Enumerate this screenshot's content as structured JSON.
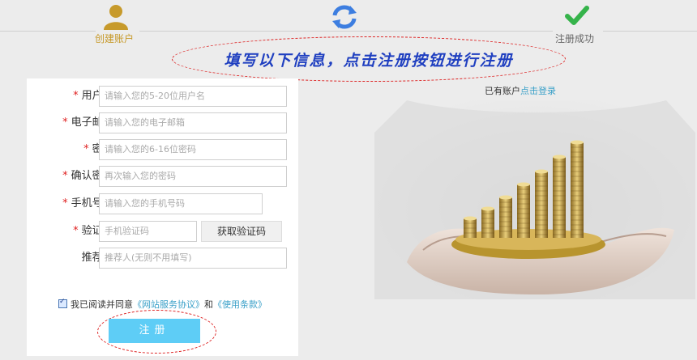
{
  "steps": [
    {
      "label": "创建账户",
      "icon": "user-icon",
      "state": "active"
    },
    {
      "label": "",
      "icon": "refresh-icon",
      "state": "pending"
    },
    {
      "label": "注册成功",
      "icon": "check-icon",
      "state": "done"
    }
  ],
  "banner": {
    "text": "填写以下信息，点击注册按钮进行注册"
  },
  "form": {
    "username": {
      "label": "用户名:",
      "placeholder": "请输入您的5-20位用户名"
    },
    "email": {
      "label": "电子邮箱:",
      "placeholder": "请输入您的电子邮箱"
    },
    "password": {
      "label": "密码:",
      "placeholder": "请输入您的6-16位密码"
    },
    "confirm": {
      "label": "确认密码:",
      "placeholder": "再次输入您的密码"
    },
    "phone": {
      "label": "手机号码:",
      "placeholder": "请输入您的手机号码"
    },
    "captcha": {
      "label": "验证码:",
      "placeholder": "手机验证码",
      "button": "获取验证码"
    },
    "referrer": {
      "label": "推荐人:",
      "placeholder": "推荐人(无则不用填写)"
    },
    "agree": {
      "prefix": "我已阅读并同意",
      "link1": "《网站服务协议》",
      "mid": "和",
      "link2": "《使用条款》",
      "checked": true
    },
    "submit_label": "注册"
  },
  "login": {
    "prefix": "已有账户",
    "link": "点击登录"
  },
  "colors": {
    "accent": "#5ecdf6",
    "required": "#e02020",
    "link": "#3aa0c8",
    "annotation": "#d22222"
  }
}
